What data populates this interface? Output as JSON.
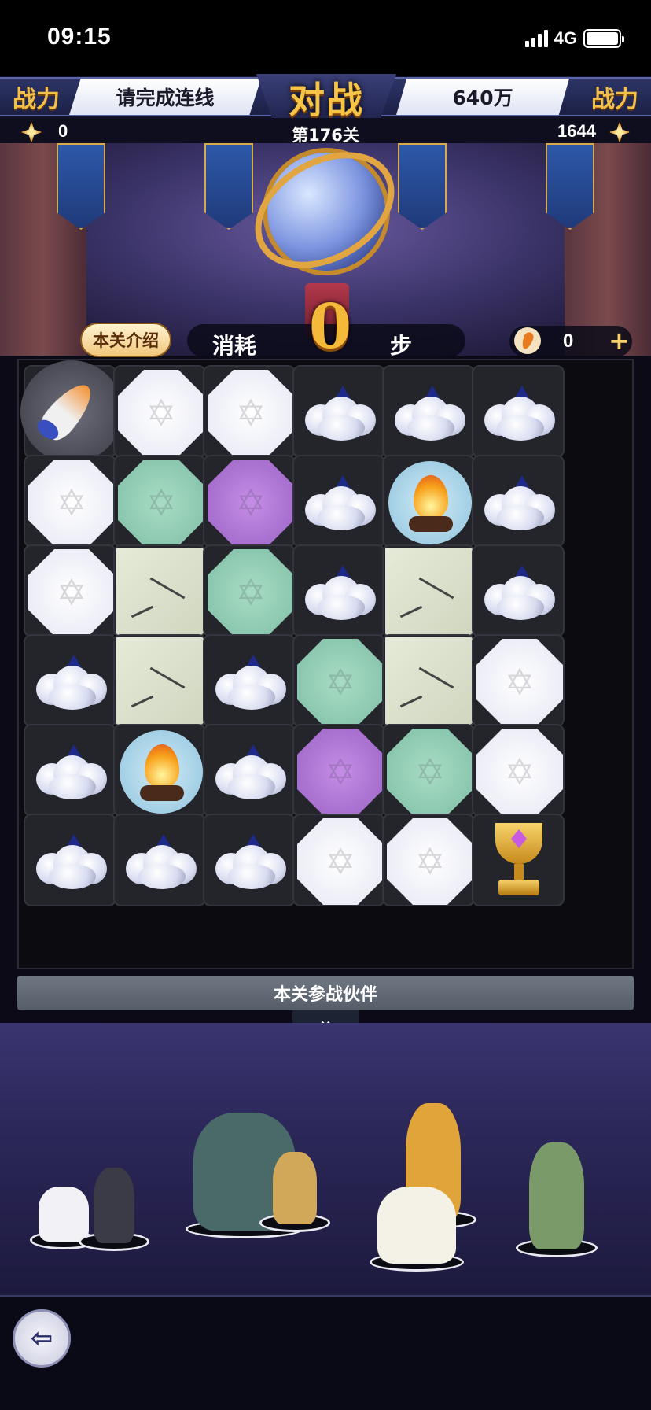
{
  "status_bar": {
    "time": "09:15",
    "network": "4G"
  },
  "header": {
    "left_power_label": "战力",
    "left_prompt": "请完成连线",
    "title": "对战",
    "right_power_value": "640万",
    "right_power_label": "战力",
    "left_score": "0",
    "level": "第176关",
    "right_score": "1644"
  },
  "info": {
    "intro_button": "本关介绍",
    "steps_label": "消耗",
    "steps_count": "0",
    "steps_unit": "步",
    "carrot_count": "0",
    "add_icon": "+"
  },
  "board": {
    "rows": 6,
    "cols": 6,
    "tiles": [
      [
        "rocket",
        "white",
        "white",
        "cloud",
        "cloud",
        "cloud"
      ],
      [
        "white",
        "green",
        "purple",
        "cloud",
        "fire",
        "cloud"
      ],
      [
        "white",
        "rock",
        "green",
        "cloud",
        "rock",
        "cloud"
      ],
      [
        "cloud",
        "rock",
        "cloud",
        "green",
        "rock",
        "white"
      ],
      [
        "cloud",
        "fire",
        "cloud",
        "purple",
        "green",
        "white"
      ],
      [
        "cloud",
        "cloud",
        "cloud",
        "white",
        "white",
        "trophy"
      ]
    ]
  },
  "partners_bar": "本关参战伙伴",
  "heroes": [
    {
      "name": "cat-hero",
      "color": "#f2f2f6"
    },
    {
      "name": "swordsman-hero",
      "color": "#3b3b48"
    },
    {
      "name": "knight-rider-hero",
      "color": "#4a6a6a"
    },
    {
      "name": "archer-hero",
      "color": "#d1a85a"
    },
    {
      "name": "monkey-king-hero",
      "color": "#e0a43a"
    },
    {
      "name": "sheep-rider-hero",
      "color": "#f4f1e6"
    },
    {
      "name": "ranger-hero",
      "color": "#7a9a6a"
    }
  ],
  "icons": {
    "exit": "exit-icon",
    "chevron": "chevron-down-icon"
  }
}
